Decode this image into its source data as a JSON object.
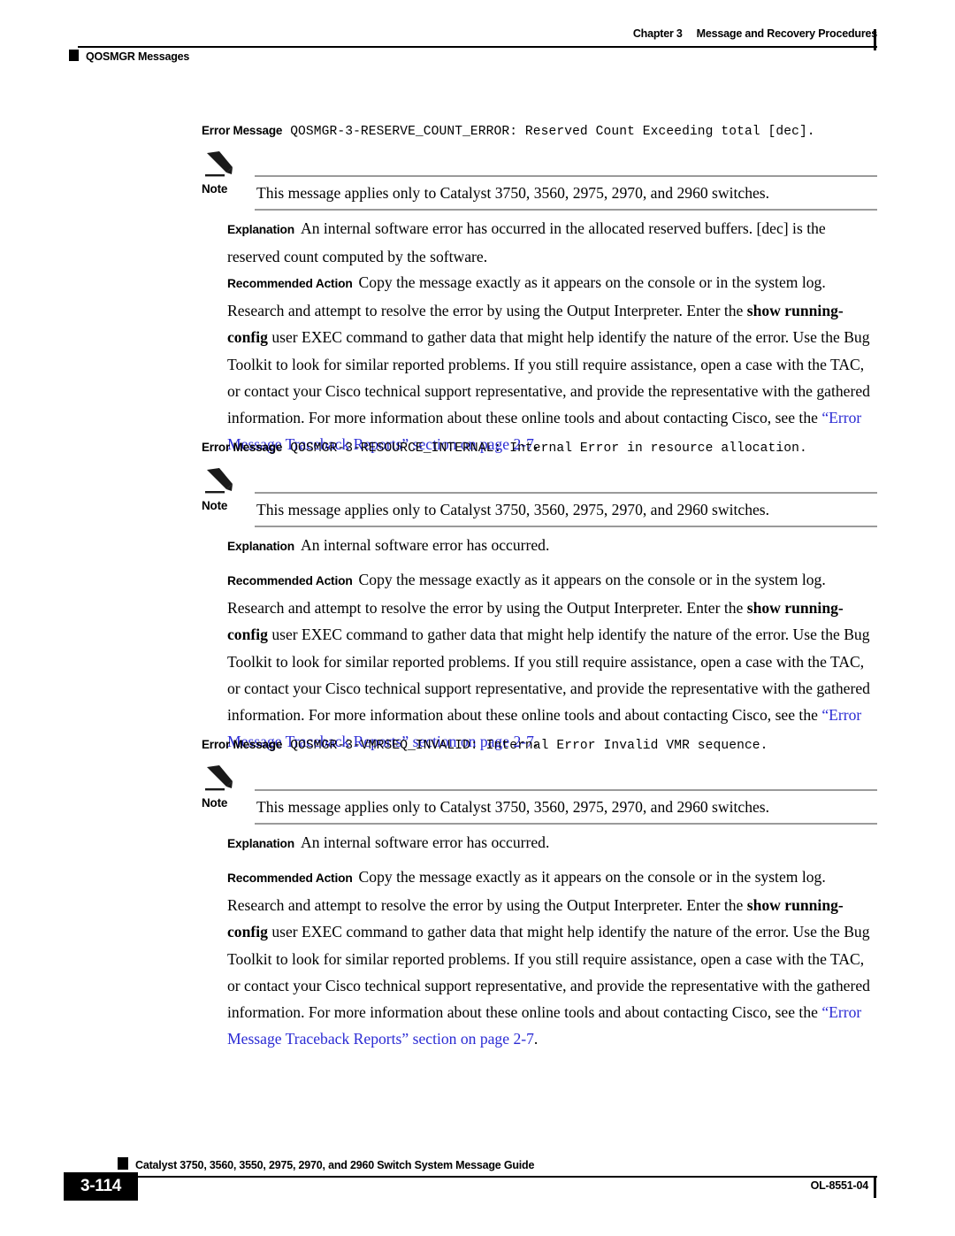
{
  "header": {
    "chapter_label": "Chapter 3",
    "chapter_title": "Message and Recovery Procedures",
    "section_title": "QOSMGR Messages"
  },
  "labels": {
    "error_message": "Error Message",
    "note": "Note",
    "explanation": "Explanation",
    "recommended_action": "Recommended Action"
  },
  "colors": {
    "link": "#2b2bd4",
    "rule": "#9a9a9a",
    "text": "#000000",
    "page_background": "#ffffff"
  },
  "messages": [
    {
      "id": "QOSMGR-3-RESERVE_COUNT_ERROR: Reserved Count Exceeding total [dec].",
      "note": "This message applies only to Catalyst 3750, 3560, 2975, 2970, and 2960 switches.",
      "explanation": "An internal software error has occurred in the allocated reserved buffers. [dec] is the reserved count computed by the software.",
      "action_part1": "Copy the message exactly as it appears on the console or in the system log. Research and attempt to resolve the error by using the Output Interpreter. Enter the ",
      "action_cmd1": "show running-config",
      "action_part2": " user EXEC command to gather data that might help identify the nature of the error. Use the Bug Toolkit to look for similar reported problems. If you still require assistance, open a case with the TAC, or contact your Cisco technical support representative, and provide the representative with the gathered information. For more information about these online tools and about contacting Cisco, see the ",
      "action_link": "“Error Message Traceback Reports” section on page 2-7",
      "action_part3": "."
    },
    {
      "id": "QOSMGR-3-RESOURCE_INTERNAL: Internal Error in resource allocation.",
      "note": "This message applies only to Catalyst 3750, 3560, 2975, 2970, and 2960 switches.",
      "explanation": "An internal software error has occurred.",
      "action_part1": "Copy the message exactly as it appears on the console or in the system log. Research and attempt to resolve the error by using the Output Interpreter. Enter the ",
      "action_cmd1": "show running-config",
      "action_part2": " user EXEC command to gather data that might help identify the nature of the error. Use the Bug Toolkit to look for similar reported problems. If you still require assistance, open a case with the TAC, or contact your Cisco technical support representative, and provide the representative with the gathered information. For more information about these online tools and about contacting Cisco, see the ",
      "action_link": "“Error Message Traceback Reports” section on page 2-7",
      "action_part3": "."
    },
    {
      "id": "QOSMGR-3-VMRSEQ_INVALID: Internal Error Invalid VMR sequence.",
      "note": "This message applies only to Catalyst 3750, 3560, 2975, 2970, and 2960 switches.",
      "explanation": "An internal software error has occurred.",
      "action_part1": "Copy the message exactly as it appears on the console or in the system log. Research and attempt to resolve the error by using the Output Interpreter. Enter the ",
      "action_cmd1": "show running-config",
      "action_part2": " user EXEC command to gather data that might help identify the nature of the error. Use the Bug Toolkit to look for similar reported problems. If you still require assistance, open a case with the TAC, or contact your Cisco technical support representative, and provide the representative with the gathered information. For more information about these online tools and about contacting Cisco, see the ",
      "action_link": "“Error Message Traceback Reports” section on page 2-7",
      "action_part3": "."
    }
  ],
  "footer": {
    "guide_title": "Catalyst 3750, 3560, 3550, 2975, 2970, and 2960 Switch System Message Guide",
    "page_number": "3-114",
    "doc_id": "OL-8551-04"
  }
}
